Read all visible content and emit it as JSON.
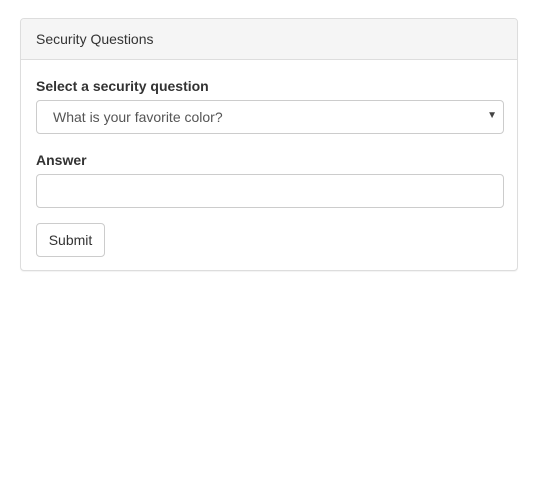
{
  "panel": {
    "title": "Security Questions"
  },
  "form": {
    "question_label": "Select a security question",
    "question_selected": "What is your favorite color?",
    "question_arrow_icon": "caret-down-icon",
    "answer_label": "Answer",
    "answer_value": "",
    "answer_placeholder": "",
    "submit_label": "Submit"
  }
}
